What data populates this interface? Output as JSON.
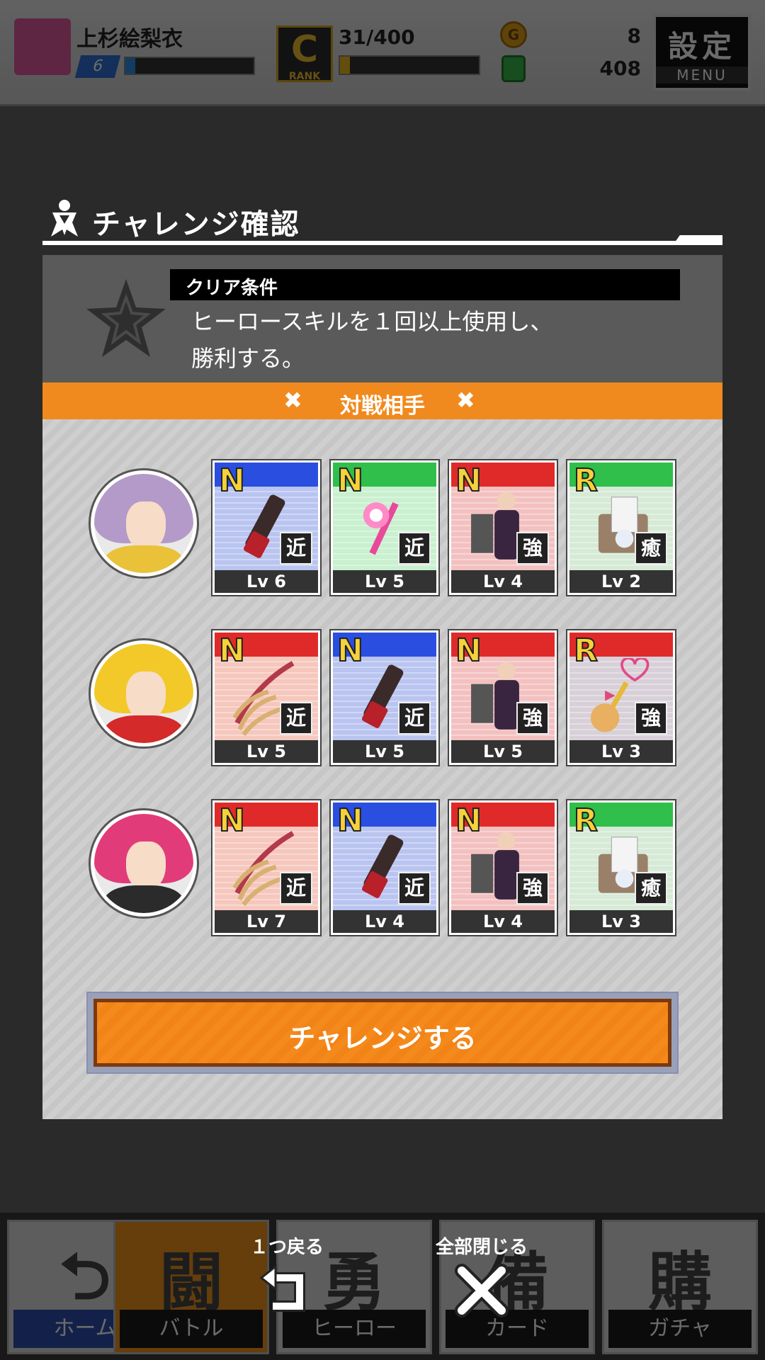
{
  "header": {
    "player_name": "上杉絵梨衣",
    "player_level": "6",
    "player_exp_progress": 0.08,
    "rank_letter": "C",
    "rank_sub": "RANK",
    "rank_count": "31/400",
    "rank_progress": 0.07,
    "coin_icon_letter": "G",
    "coins": "8",
    "gems": "408",
    "menu_main": "設定",
    "menu_sub": "MENU"
  },
  "dialog": {
    "title": "チャレンジ確認",
    "condition_label": "クリア条件",
    "condition_text_line1": "ヒーロースキルを１回以上使用し、",
    "condition_text_line2": "勝利する。",
    "opponents_header": "対戦相手",
    "challenge_button": "チャレンジする"
  },
  "opponents": [
    {
      "avatar_colors": {
        "hair": "#b49ac8",
        "cloth": "#e9c23a"
      },
      "cards": [
        {
          "rarity": "N",
          "band": "#2a4fe0",
          "bg": "#b9c4f0",
          "type": "近",
          "lv": "Lv 6",
          "art": "chainsaw-icon"
        },
        {
          "rarity": "N",
          "band": "#2fbf4a",
          "bg": "#c9f0cf",
          "type": "近",
          "lv": "Lv 5",
          "art": "wand-icon"
        },
        {
          "rarity": "N",
          "band": "#e02a2a",
          "bg": "#f3c0c0",
          "type": "強",
          "lv": "Lv 4",
          "art": "gentleman-icon"
        },
        {
          "rarity": "R",
          "band": "#2fbf4a",
          "bg": "#d6ead6",
          "type": "癒",
          "lv": "Lv 2",
          "art": "medkit-icon"
        }
      ]
    },
    {
      "avatar_colors": {
        "hair": "#f2c928",
        "cloth": "#d42a2a"
      },
      "cards": [
        {
          "rarity": "N",
          "band": "#e02a2a",
          "bg": "#f6c7bd",
          "type": "近",
          "lv": "Lv 5",
          "art": "claw-icon"
        },
        {
          "rarity": "N",
          "band": "#2a4fe0",
          "bg": "#b9c4f0",
          "type": "近",
          "lv": "Lv 5",
          "art": "chainsaw-icon"
        },
        {
          "rarity": "N",
          "band": "#e02a2a",
          "bg": "#f3c0c0",
          "type": "強",
          "lv": "Lv 5",
          "art": "gentleman-icon"
        },
        {
          "rarity": "R",
          "band": "#e02a2a",
          "bg": "#d8d0d8",
          "type": "強",
          "lv": "Lv 3",
          "art": "magical-items-icon"
        }
      ]
    },
    {
      "avatar_colors": {
        "hair": "#e23b7a",
        "cloth": "#2b2b2b"
      },
      "cards": [
        {
          "rarity": "N",
          "band": "#e02a2a",
          "bg": "#f6c7bd",
          "type": "近",
          "lv": "Lv 7",
          "art": "claw-icon"
        },
        {
          "rarity": "N",
          "band": "#2a4fe0",
          "bg": "#b9c4f0",
          "type": "近",
          "lv": "Lv 4",
          "art": "chainsaw-icon"
        },
        {
          "rarity": "N",
          "band": "#e02a2a",
          "bg": "#f3c0c0",
          "type": "強",
          "lv": "Lv 4",
          "art": "gentleman-icon"
        },
        {
          "rarity": "R",
          "band": "#2fbf4a",
          "bg": "#d6ead6",
          "type": "癒",
          "lv": "Lv 3",
          "art": "medkit-icon"
        }
      ]
    }
  ],
  "bottom_nav": [
    {
      "glyph": "⮌",
      "label": "ホーム"
    },
    {
      "glyph": "闘",
      "label": "バトル"
    },
    {
      "glyph": "勇",
      "label": "ヒーロー"
    },
    {
      "glyph": "備",
      "label": "カード"
    },
    {
      "glyph": "購",
      "label": "ガチャ"
    }
  ],
  "controls": {
    "back_label": "１つ戻る",
    "close_all_label": "全部閉じる"
  },
  "colors": {
    "accent_orange": "#f08a1e",
    "panel_dark": "#5a5a5a"
  }
}
